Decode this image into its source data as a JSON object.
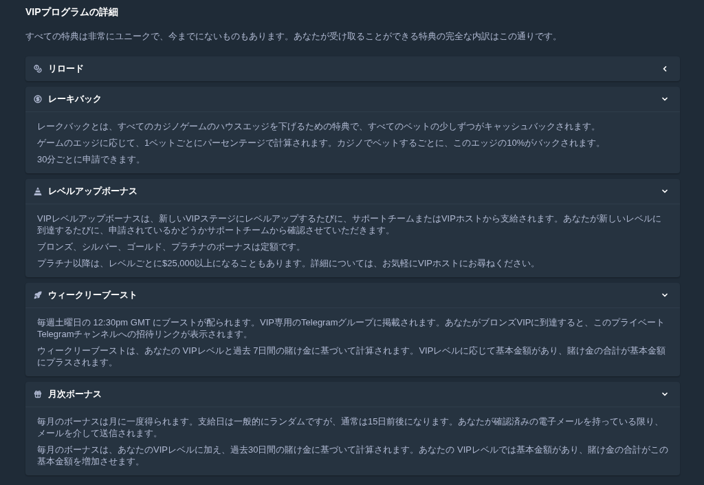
{
  "page": {
    "title": "VIPプログラムの詳細",
    "intro": "すべての特典は非常にユニークで、今までにないものもあります。あなたが受け取ることができる特典の完全な内訳はこの通りです。"
  },
  "sections": [
    {
      "title": "リロード",
      "expanded": false
    },
    {
      "title": "レーキバック",
      "expanded": true,
      "paragraphs": [
        "レークバックとは、すべてのカジノゲームのハウスエッジを下げるための特典で、すべてのベットの少しずつがキャッシュバックされます。",
        "ゲームのエッジに応じて、1ベットごとにパーセンテージで計算されます。カジノでベットするごとに、このエッジの10%がバックされます。",
        "30分ごとに申請できます。"
      ]
    },
    {
      "title": "レベルアップボーナス",
      "expanded": true,
      "paragraphs": [
        "VIPレベルアップボーナスは、新しいVIPステージにレベルアップするたびに、サポートチームまたはVIPホストから支給されます。あなたが新しいレベルに到達するたびに、申請されているかどうかサポートチームから確認させていただきます。",
        "ブロンズ、シルバー、ゴールド、プラチナのボーナスは定額です。",
        "プラチナ以降は、レベルごとに$25,000以上になることもあります。詳細については、お気軽にVIPホストにお尋ねください。"
      ]
    },
    {
      "title": "ウィークリーブースト",
      "expanded": true,
      "paragraphs": [
        "毎週土曜日の 12:30pm GMT にブーストが配られます。VIP専用のTelegramグループに掲載されます。あなたがブロンズVIPに到達すると、このプライベートTelegramチャンネルへの招待リンクが表示されます。",
        "ウィークリーブーストは、あなたの VIPレベルと過去 7日間の賭け金に基づいて計算されます。VIPレベルに応じて基本金額があり、賭け金の合計が基本金額にプラスされます。"
      ]
    },
    {
      "title": "月次ボーナス",
      "expanded": true,
      "paragraphs": [
        "毎月のボーナスは月に一度得られます。支給日は一般的にランダムですが、通常は15日前後になります。あなたが確認済みの電子メールを持っている限り、メールを介して送信されます。",
        "毎月のボーナスは、あなたのVIPレベルに加え、過去30日間の賭け金に基づいて計算されます。あなたの VIPレベルでは基本金額があり、賭け金の合計がこの基本金額を増加させます。"
      ]
    }
  ]
}
